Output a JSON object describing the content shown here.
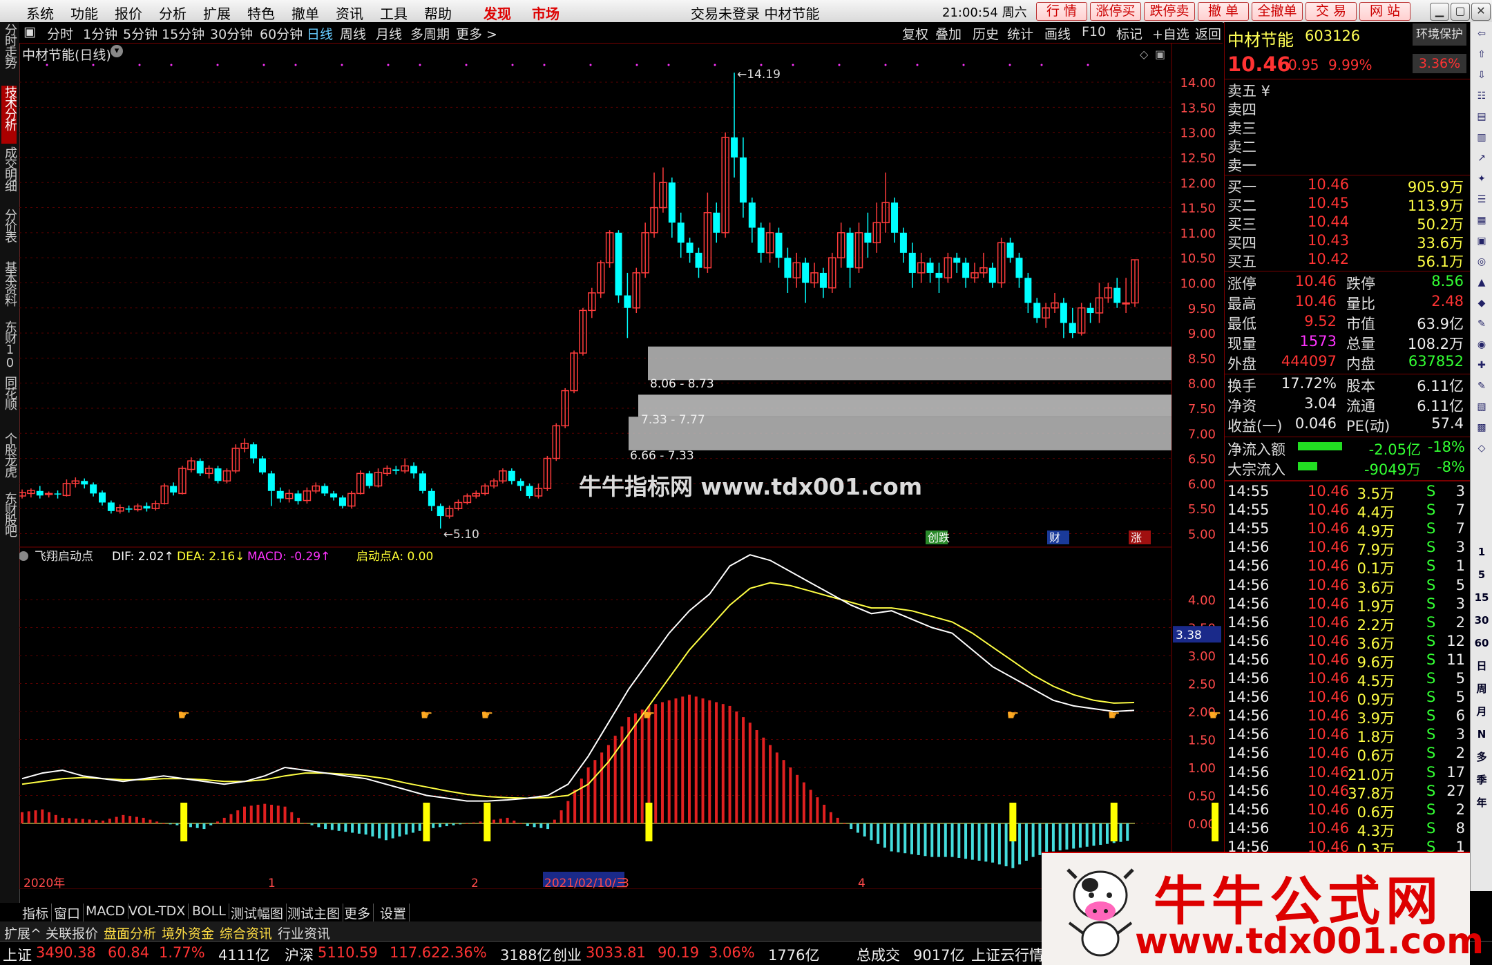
{
  "menu": {
    "items": [
      "系统",
      "功能",
      "报价",
      "分析",
      "扩展",
      "特色",
      "撤单",
      "资讯",
      "工具",
      "帮助"
    ],
    "highlight": [
      "发现",
      "市场"
    ],
    "center_title": "交易未登录  中材节能",
    "clock": "21:00:54 周六",
    "quick_buttons": [
      "行 情",
      "涨停买",
      "跌停卖",
      "撤 单",
      "全撤单",
      "交 易",
      "网 站"
    ]
  },
  "periods": [
    "分时",
    "1分钟",
    "5分钟",
    "15分钟",
    "30分钟",
    "60分钟",
    "日线",
    "周线",
    "月线",
    "多周期",
    "更多 >"
  ],
  "active_period": "日线",
  "tools": [
    "复权",
    "叠加",
    "历史",
    "统计",
    "画线",
    "F10",
    "标记",
    "+自选",
    "返回"
  ],
  "left_tabs": [
    "分时走势",
    "技术分析",
    "成交明细",
    "分价表",
    "基本资料",
    "东财10",
    "同花顺10",
    "个股龙虎",
    "东财股吧"
  ],
  "chart_title": "中材节能(日线)",
  "price_axis": [
    "14.00",
    "13.50",
    "13.00",
    "12.50",
    "12.00",
    "11.50",
    "11.00",
    "10.50",
    "10.00",
    "9.50",
    "9.00",
    "8.50",
    "8.00",
    "7.50",
    "7.00",
    "6.50",
    "6.00",
    "5.50",
    "5.00"
  ],
  "annotations": {
    "high": "14.19",
    "low": "5.10"
  },
  "zones": [
    "8.06 - 8.73",
    "7.33 - 7.77",
    "6.66 - 7.33"
  ],
  "event_tags": [
    "创跌",
    "财",
    "涨"
  ],
  "indicator": {
    "name": "飞翔启动点",
    "dif": "DIF: 2.02↑",
    "dea": "DEA: 2.16↓",
    "macd": "MACD: -0.29↑",
    "start": "启动点A: 0.00",
    "axis": [
      "4.00",
      "3.50",
      "3.00",
      "2.50",
      "2.00",
      "1.50",
      "1.00",
      "0.50",
      "0.00"
    ],
    "cur_value": "3.38"
  },
  "time_axis": [
    "2020年",
    "1",
    "2",
    "2021/02/10/三",
    "3",
    "4"
  ],
  "chart_data": {
    "type": "candlestick",
    "ylim": [
      4.8,
      14.4
    ],
    "candles": [
      [
        5.75,
        5.82,
        5.7,
        5.88
      ],
      [
        5.8,
        5.86,
        5.72,
        5.9
      ],
      [
        5.85,
        5.76,
        5.7,
        5.95
      ],
      [
        5.78,
        5.8,
        5.72,
        5.84
      ],
      [
        5.8,
        5.78,
        5.7,
        5.86
      ],
      [
        5.76,
        6.0,
        5.74,
        6.08
      ],
      [
        6.0,
        6.05,
        5.92,
        6.12
      ],
      [
        6.05,
        5.98,
        5.9,
        6.1
      ],
      [
        5.98,
        5.8,
        5.74,
        6.02
      ],
      [
        5.82,
        5.62,
        5.56,
        5.86
      ],
      [
        5.62,
        5.45,
        5.4,
        5.66
      ],
      [
        5.45,
        5.52,
        5.4,
        5.58
      ],
      [
        5.5,
        5.48,
        5.42,
        5.56
      ],
      [
        5.48,
        5.55,
        5.44,
        5.6
      ],
      [
        5.55,
        5.5,
        5.44,
        5.62
      ],
      [
        5.5,
        5.6,
        5.46,
        5.66
      ],
      [
        5.6,
        5.95,
        5.58,
        6.0
      ],
      [
        5.95,
        5.82,
        5.76,
        6.02
      ],
      [
        5.8,
        6.3,
        5.78,
        6.35
      ],
      [
        6.28,
        6.45,
        6.22,
        6.52
      ],
      [
        6.45,
        6.2,
        6.15,
        6.5
      ],
      [
        6.2,
        6.3,
        6.1,
        6.36
      ],
      [
        6.3,
        6.05,
        6.0,
        6.35
      ],
      [
        6.05,
        6.25,
        6.0,
        6.3
      ],
      [
        6.25,
        6.7,
        6.2,
        6.78
      ],
      [
        6.7,
        6.8,
        6.62,
        6.9
      ],
      [
        6.78,
        6.5,
        6.4,
        6.82
      ],
      [
        6.5,
        6.22,
        6.18,
        6.55
      ],
      [
        6.2,
        5.85,
        5.55,
        6.25
      ],
      [
        5.85,
        5.7,
        5.62,
        5.92
      ],
      [
        5.7,
        5.8,
        5.62,
        5.88
      ],
      [
        5.8,
        5.65,
        5.58,
        5.86
      ],
      [
        5.66,
        5.85,
        5.6,
        5.92
      ],
      [
        5.85,
        5.95,
        5.8,
        6.02
      ],
      [
        5.95,
        5.8,
        5.75,
        6.0
      ],
      [
        5.8,
        5.72,
        5.66,
        5.85
      ],
      [
        5.72,
        5.55,
        5.5,
        5.76
      ],
      [
        5.55,
        5.8,
        5.5,
        5.85
      ],
      [
        5.8,
        6.2,
        5.78,
        6.26
      ],
      [
        6.2,
        5.95,
        5.9,
        6.25
      ],
      [
        5.95,
        6.22,
        5.92,
        6.3
      ],
      [
        6.2,
        6.3,
        6.15,
        6.36
      ],
      [
        6.28,
        6.25,
        6.18,
        6.35
      ],
      [
        6.25,
        6.35,
        6.2,
        6.5
      ],
      [
        6.35,
        6.2,
        6.1,
        6.42
      ],
      [
        6.2,
        5.85,
        5.8,
        6.25
      ],
      [
        5.85,
        5.55,
        5.45,
        5.9
      ],
      [
        5.55,
        5.35,
        5.1,
        5.6
      ],
      [
        5.35,
        5.5,
        5.3,
        5.56
      ],
      [
        5.5,
        5.62,
        5.46,
        5.68
      ],
      [
        5.62,
        5.75,
        5.58,
        5.8
      ],
      [
        5.75,
        5.8,
        5.7,
        5.86
      ],
      [
        5.8,
        5.95,
        5.76,
        6.0
      ],
      [
        5.95,
        6.05,
        5.9,
        6.1
      ],
      [
        6.05,
        6.25,
        6.0,
        6.3
      ],
      [
        6.25,
        6.05,
        5.98,
        6.3
      ],
      [
        6.05,
        5.95,
        5.85,
        6.1
      ],
      [
        5.95,
        5.75,
        5.7,
        6.0
      ],
      [
        5.75,
        5.9,
        5.7,
        6.0
      ],
      [
        5.9,
        6.5,
        5.85,
        6.55
      ],
      [
        6.5,
        7.15,
        6.45,
        7.2
      ],
      [
        7.15,
        7.85,
        7.1,
        7.9
      ],
      [
        7.85,
        8.6,
        7.8,
        8.65
      ],
      [
        8.6,
        9.45,
        8.55,
        9.5
      ],
      [
        9.45,
        9.8,
        9.3,
        9.9
      ],
      [
        9.8,
        10.4,
        9.7,
        10.45
      ],
      [
        10.4,
        11.0,
        10.3,
        11.05
      ],
      [
        11.0,
        9.75,
        9.6,
        11.05
      ],
      [
        9.75,
        9.5,
        8.9,
        10.2
      ],
      [
        9.5,
        10.2,
        9.4,
        10.3
      ],
      [
        10.2,
        11.0,
        10.1,
        11.2
      ],
      [
        11.0,
        11.5,
        10.9,
        12.2
      ],
      [
        11.5,
        12.0,
        11.4,
        12.3
      ],
      [
        12.0,
        11.2,
        10.9,
        12.1
      ],
      [
        11.2,
        10.8,
        10.5,
        11.4
      ],
      [
        10.8,
        10.6,
        10.4,
        10.9
      ],
      [
        10.6,
        10.3,
        10.1,
        10.7
      ],
      [
        10.3,
        11.4,
        10.2,
        11.8
      ],
      [
        11.4,
        11.0,
        10.8,
        11.6
      ],
      [
        11.0,
        12.9,
        10.9,
        13.0
      ],
      [
        12.9,
        12.5,
        12.1,
        14.19
      ],
      [
        12.5,
        11.6,
        11.3,
        12.9
      ],
      [
        11.6,
        11.1,
        10.8,
        11.7
      ],
      [
        11.1,
        10.6,
        10.4,
        11.2
      ],
      [
        10.6,
        11.0,
        10.4,
        11.2
      ],
      [
        11.0,
        10.5,
        10.3,
        11.1
      ],
      [
        10.5,
        10.1,
        9.8,
        10.7
      ],
      [
        10.1,
        10.4,
        9.9,
        10.6
      ],
      [
        10.4,
        10.0,
        9.6,
        10.5
      ],
      [
        10.0,
        10.2,
        9.9,
        10.4
      ],
      [
        10.2,
        9.9,
        9.7,
        10.3
      ],
      [
        9.9,
        10.5,
        9.8,
        10.6
      ],
      [
        10.5,
        11.0,
        10.3,
        11.2
      ],
      [
        11.0,
        10.3,
        9.9,
        11.1
      ],
      [
        10.3,
        11.0,
        10.2,
        11.2
      ],
      [
        11.0,
        10.8,
        10.5,
        11.4
      ],
      [
        10.8,
        11.2,
        10.6,
        11.6
      ],
      [
        11.2,
        11.6,
        11.0,
        12.2
      ],
      [
        11.6,
        11.0,
        10.8,
        11.7
      ],
      [
        11.0,
        10.6,
        10.4,
        11.1
      ],
      [
        10.6,
        10.2,
        9.9,
        10.8
      ],
      [
        10.2,
        10.4,
        10.0,
        10.6
      ],
      [
        10.4,
        10.2,
        10.0,
        10.5
      ],
      [
        10.2,
        10.1,
        9.8,
        10.4
      ],
      [
        10.1,
        10.5,
        10.0,
        10.6
      ],
      [
        10.5,
        10.4,
        10.2,
        10.6
      ],
      [
        10.4,
        10.1,
        9.9,
        10.5
      ],
      [
        10.1,
        10.2,
        10.0,
        10.4
      ],
      [
        10.2,
        10.3,
        10.1,
        10.6
      ],
      [
        10.3,
        10.0,
        9.9,
        10.4
      ],
      [
        10.0,
        10.8,
        9.9,
        10.9
      ],
      [
        10.8,
        10.5,
        10.4,
        10.9
      ],
      [
        10.5,
        10.1,
        9.9,
        10.6
      ],
      [
        10.1,
        9.6,
        9.4,
        10.2
      ],
      [
        9.6,
        9.3,
        9.2,
        9.7
      ],
      [
        9.3,
        9.5,
        9.1,
        9.6
      ],
      [
        9.5,
        9.6,
        9.4,
        9.8
      ],
      [
        9.6,
        9.2,
        8.9,
        9.7
      ],
      [
        9.2,
        9.0,
        8.9,
        9.5
      ],
      [
        9.0,
        9.5,
        8.95,
        9.6
      ],
      [
        9.5,
        9.4,
        9.2,
        9.6
      ],
      [
        9.4,
        9.7,
        9.2,
        10.0
      ],
      [
        9.7,
        9.9,
        9.6,
        10.0
      ],
      [
        9.9,
        9.6,
        9.5,
        10.1
      ],
      [
        9.6,
        9.6,
        9.4,
        10.1
      ],
      [
        9.6,
        10.46,
        9.52,
        10.46
      ]
    ],
    "dif": [
      0.8,
      0.9,
      0.95,
      0.85,
      0.8,
      0.75,
      0.8,
      0.85,
      0.8,
      0.75,
      0.7,
      0.75,
      0.85,
      1.0,
      0.95,
      0.9,
      0.85,
      0.8,
      0.7,
      0.6,
      0.5,
      0.45,
      0.4,
      0.4,
      0.42,
      0.45,
      0.5,
      0.7,
      1.2,
      1.8,
      2.4,
      2.9,
      3.4,
      3.8,
      4.1,
      4.6,
      4.8,
      4.7,
      4.5,
      4.3,
      4.1,
      3.9,
      3.75,
      3.8,
      3.65,
      3.5,
      3.4,
      3.1,
      2.8,
      2.6,
      2.4,
      2.2,
      2.1,
      2.05,
      2.0,
      2.02
    ],
    "dea": [
      0.7,
      0.75,
      0.8,
      0.82,
      0.8,
      0.78,
      0.78,
      0.8,
      0.8,
      0.78,
      0.75,
      0.75,
      0.78,
      0.85,
      0.9,
      0.9,
      0.88,
      0.85,
      0.8,
      0.72,
      0.65,
      0.58,
      0.52,
      0.48,
      0.46,
      0.45,
      0.46,
      0.5,
      0.7,
      1.1,
      1.6,
      2.1,
      2.6,
      3.1,
      3.5,
      3.9,
      4.2,
      4.3,
      4.25,
      4.15,
      4.05,
      3.95,
      3.85,
      3.85,
      3.8,
      3.7,
      3.6,
      3.4,
      3.15,
      2.9,
      2.65,
      2.45,
      2.3,
      2.2,
      2.15,
      2.16
    ],
    "macd": [
      0.2,
      0.25,
      0.1,
      0.08,
      0.05,
      0.15,
      0.1,
      0.0,
      -0.05,
      -0.1,
      0.1,
      0.3,
      0.35,
      0.3,
      0.0,
      -0.1,
      -0.15,
      -0.2,
      -0.3,
      -0.2,
      -0.1,
      -0.05,
      0.0,
      0.05,
      0.1,
      -0.05,
      -0.1,
      0.4,
      1.0,
      1.4,
      1.9,
      2.1,
      2.2,
      2.3,
      2.2,
      2.1,
      1.8,
      1.4,
      1.0,
      0.6,
      0.2,
      -0.1,
      -0.3,
      -0.5,
      -0.55,
      -0.6,
      -0.6,
      -0.65,
      -0.7,
      -0.8,
      -0.6,
      -0.5,
      -0.45,
      -0.4,
      -0.35,
      -0.29
    ],
    "start_points": [
      8,
      20,
      23,
      31,
      49,
      54,
      59
    ]
  },
  "quote": {
    "name": "中材节能",
    "code": "603126",
    "env": "环境保护",
    "price": "10.46",
    "change": "0.95",
    "pct": "9.99%",
    "env_pct": "3.36%",
    "sells": [
      "卖五 ¥",
      "卖四",
      "卖三",
      "卖二",
      "卖一"
    ],
    "buys": [
      {
        "label": "买一",
        "price": "10.46",
        "vol": "905.9万"
      },
      {
        "label": "买二",
        "price": "10.45",
        "vol": "113.9万"
      },
      {
        "label": "买三",
        "price": "10.44",
        "vol": "50.2万"
      },
      {
        "label": "买四",
        "price": "10.43",
        "vol": "33.6万"
      },
      {
        "label": "买五",
        "price": "10.42",
        "vol": "56.1万"
      }
    ],
    "stats": [
      [
        "涨停",
        "10.46",
        "跌停",
        "8.56"
      ],
      [
        "最高",
        "10.46",
        "量比",
        "2.48"
      ],
      [
        "最低",
        "9.52",
        "市值",
        "63.9亿"
      ],
      [
        "现量",
        "1573",
        "总量",
        "108.2万"
      ],
      [
        "外盘",
        "444097",
        "内盘",
        "637852"
      ],
      [
        "换手",
        "17.72%",
        "股本",
        "6.11亿"
      ],
      [
        "净资",
        "3.04",
        "流通",
        "6.11亿"
      ],
      [
        "收益(一)",
        "0.046",
        "PE(动)",
        "57.4"
      ]
    ],
    "flows": [
      {
        "label": "净流入额",
        "value": "-2.05亿",
        "pct": "-18%",
        "bar": 0.8
      },
      {
        "label": "大宗流入",
        "value": "-9049万",
        "pct": "-8%",
        "bar": 0.35
      }
    ]
  },
  "ticks": [
    [
      "14:55",
      "10.46",
      "3.5万",
      "S",
      "3"
    ],
    [
      "14:55",
      "10.46",
      "4.4万",
      "S",
      "7"
    ],
    [
      "14:55",
      "10.46",
      "4.9万",
      "S",
      "7"
    ],
    [
      "14:56",
      "10.46",
      "7.9万",
      "S",
      "3"
    ],
    [
      "14:56",
      "10.46",
      "0.1万",
      "S",
      "1"
    ],
    [
      "14:56",
      "10.46",
      "3.6万",
      "S",
      "5"
    ],
    [
      "14:56",
      "10.46",
      "1.9万",
      "S",
      "3"
    ],
    [
      "14:56",
      "10.46",
      "2.2万",
      "S",
      "2"
    ],
    [
      "14:56",
      "10.46",
      "3.6万",
      "S",
      "12"
    ],
    [
      "14:56",
      "10.46",
      "9.6万",
      "S",
      "11"
    ],
    [
      "14:56",
      "10.46",
      "4.5万",
      "S",
      "5"
    ],
    [
      "14:56",
      "10.46",
      "0.9万",
      "S",
      "5"
    ],
    [
      "14:56",
      "10.46",
      "3.9万",
      "S",
      "6"
    ],
    [
      "14:56",
      "10.46",
      "1.8万",
      "S",
      "3"
    ],
    [
      "14:56",
      "10.46",
      "0.6万",
      "S",
      "2"
    ],
    [
      "14:56",
      "10.46",
      "21.0万",
      "S",
      "17"
    ],
    [
      "14:56",
      "10.46",
      "37.8万",
      "S",
      "27"
    ],
    [
      "14:56",
      "10.46",
      "0.6万",
      "S",
      "2"
    ],
    [
      "14:56",
      "10.46",
      "4.3万",
      "S",
      "8"
    ],
    [
      "14:56",
      "10.46",
      "0.3万",
      "S",
      "1"
    ]
  ],
  "right_icons": [
    "1",
    "5",
    "15",
    "30",
    "60",
    "日",
    "周",
    "月",
    "N",
    "多",
    "季",
    "年"
  ],
  "bottom": {
    "indicator_tabs": [
      "指标",
      "窗口",
      "MACD",
      "VOL-TDX",
      "BOLL",
      "测试幅图",
      "测试主图",
      "更多",
      "设置"
    ],
    "ext_tabs": [
      "扩展^",
      "关联报价",
      "盘面分析",
      "境外资金",
      "综合资讯",
      "行业资讯"
    ]
  },
  "status": [
    {
      "label": "上证",
      "v1": "3490.38",
      "v2": "60.84",
      "v3": "1.77%",
      "v4": "4111亿"
    },
    {
      "label": "沪深",
      "v1": "5110.59",
      "v2": "117.62",
      "v3": "2.36%",
      "v4": "3188亿"
    },
    {
      "label": "创业",
      "v1": "3033.81",
      "v2": "90.19",
      "v3": "3.06%",
      "v4": "1776亿"
    }
  ],
  "status_extra": [
    "总成交",
    "9017亿",
    "上证云行情"
  ],
  "watermark": "牛牛指标网 www.tdx001.com",
  "ad": {
    "title": "牛牛公式网",
    "url": "www.tdx001.com"
  }
}
